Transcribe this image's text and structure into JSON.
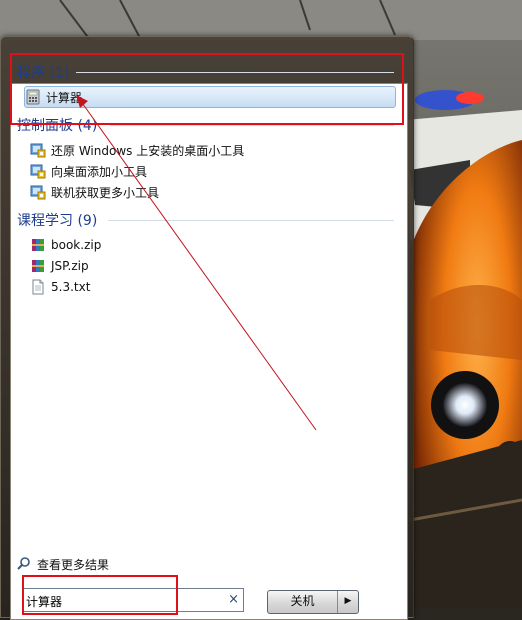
{
  "groups": {
    "programs": {
      "header": "程序 (1)",
      "items": [
        {
          "label": "计算器",
          "icon": "calculator-icon"
        }
      ]
    },
    "control_panel": {
      "header": "控制面板 (4)",
      "items": [
        {
          "label": "还原 Windows 上安装的桌面小工具",
          "icon": "gadget-icon"
        },
        {
          "label": "向桌面添加小工具",
          "icon": "gadget-icon"
        },
        {
          "label": "联机获取更多小工具",
          "icon": "gadget-icon"
        }
      ]
    },
    "course": {
      "header": "课程学习 (9)",
      "items": [
        {
          "label": "book.zip",
          "icon": "winrar-archive-icon"
        },
        {
          "label": "JSP.zip",
          "icon": "winrar-archive-icon"
        },
        {
          "label": "5.3.txt",
          "icon": "text-file-icon"
        }
      ]
    }
  },
  "see_more": {
    "label": "查看更多结果",
    "icon": "search-icon"
  },
  "search": {
    "value": "计算器",
    "clear": "×"
  },
  "shutdown": {
    "label": "关机",
    "arrow": "▶"
  },
  "colors": {
    "header_text": "#1e3d8f",
    "highlight_border": "#8fb4dd",
    "annotation_red": "#e0101a"
  }
}
